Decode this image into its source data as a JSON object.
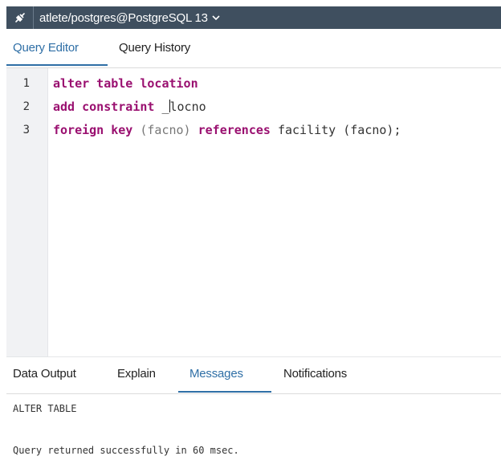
{
  "connection": {
    "label": "atlete/postgres@PostgreSQL 13",
    "icon": "connection-plug-icon",
    "caret_icon": "chevron-down-icon"
  },
  "top_tabs": [
    {
      "label": "Query Editor",
      "active": true
    },
    {
      "label": "Query History",
      "active": false
    }
  ],
  "editor": {
    "line_numbers": [
      "1",
      "2",
      "3"
    ],
    "lines": [
      [
        {
          "t": "alter table location",
          "c": "kw"
        }
      ],
      [
        {
          "t": "add constraint ",
          "c": "kw"
        },
        {
          "t": "_",
          "c": "id"
        },
        {
          "t": "",
          "c": "cursor"
        },
        {
          "t": "locno",
          "c": "id"
        }
      ],
      [
        {
          "t": "foreign key ",
          "c": "kw"
        },
        {
          "t": "(facno) ",
          "c": "paren"
        },
        {
          "t": "references ",
          "c": "kw"
        },
        {
          "t": "facility (facno);",
          "c": "id"
        }
      ]
    ]
  },
  "bottom_tabs": [
    {
      "label": "Data Output",
      "active": false
    },
    {
      "label": "Explain",
      "active": false
    },
    {
      "label": "Messages",
      "active": true
    },
    {
      "label": "Notifications",
      "active": false
    }
  ],
  "messages": {
    "line1": "ALTER TABLE",
    "line2": "Query returned successfully in 60 msec."
  },
  "colors": {
    "accent": "#2f6fa6",
    "keyword": "#9a1070",
    "toolbar_bg": "#3f4f5f"
  }
}
